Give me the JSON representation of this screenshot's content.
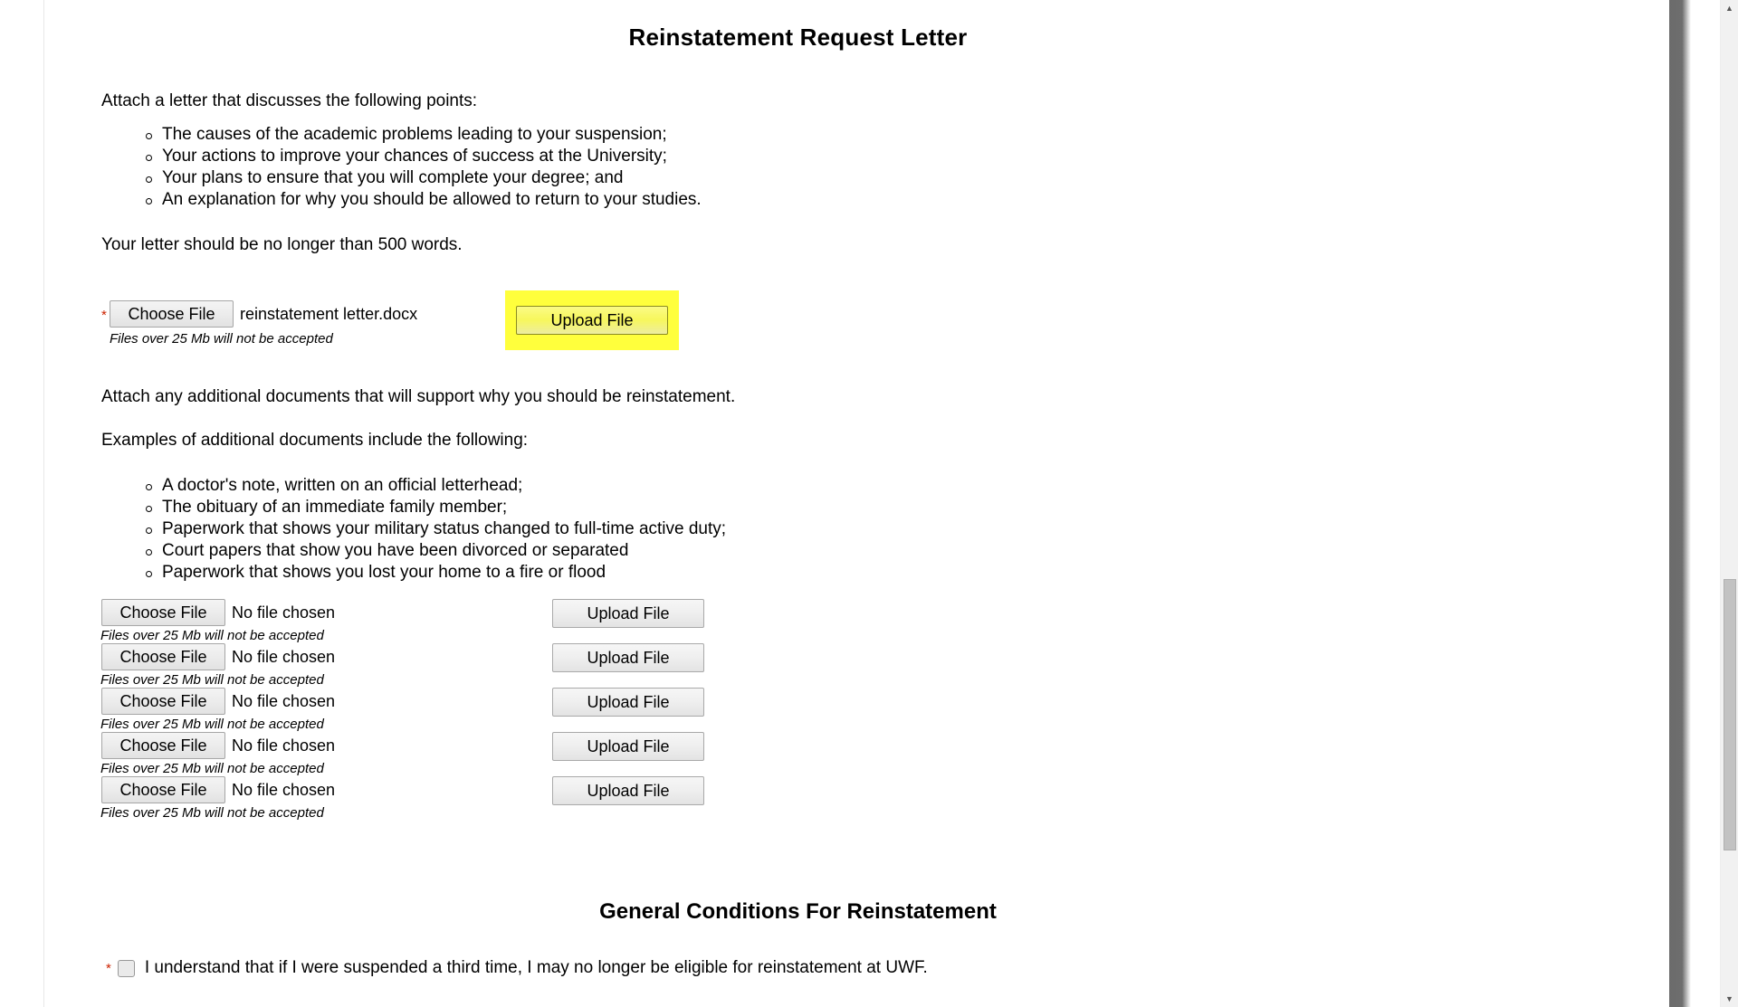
{
  "page": {
    "title": "Reinstatement Request Letter",
    "section_title": "General Conditions For Reinstatement"
  },
  "letter_section": {
    "intro": "Attach a letter that discusses the following points:",
    "points": [
      "The causes of the academic problems leading to your suspension;",
      "Your actions to improve your chances of success at the University;",
      "Your plans to ensure that you will complete your degree; and",
      "An explanation for why you should be allowed to return to your studies."
    ],
    "word_limit": "Your letter should be no longer than 500 words.",
    "upload": {
      "required_marker": "*",
      "choose_file_label": "Choose File",
      "file_name": "reinstatement letter.docx",
      "size_note": "Files over 25 Mb will not be accepted",
      "upload_label": "Upload File",
      "highlighted": true,
      "highlight_color": "#ffff3c"
    }
  },
  "additional_section": {
    "intro": "Attach any additional documents that will support why you should be reinstatement.",
    "examples_intro": "Examples of additional documents include the following:",
    "examples": [
      "A doctor's note, written on an official letterhead;",
      "The obituary of an immediate family member;",
      "Paperwork that shows your military status changed to full-time active duty;",
      "Court papers that show you have been divorced or separated",
      "Paperwork that shows you lost your home to a fire or flood"
    ],
    "rows": [
      {
        "choose_file_label": "Choose File",
        "file_name": "No file chosen",
        "size_note": "Files over 25 Mb will not be accepted",
        "upload_label": "Upload File"
      },
      {
        "choose_file_label": "Choose File",
        "file_name": "No file chosen",
        "size_note": "Files over 25 Mb will not be accepted",
        "upload_label": "Upload File"
      },
      {
        "choose_file_label": "Choose File",
        "file_name": "No file chosen",
        "size_note": "Files over 25 Mb will not be accepted",
        "upload_label": "Upload File"
      },
      {
        "choose_file_label": "Choose File",
        "file_name": "No file chosen",
        "size_note": "Files over 25 Mb will not be accepted",
        "upload_label": "Upload File"
      },
      {
        "choose_file_label": "Choose File",
        "file_name": "No file chosen",
        "size_note": "Files over 25 Mb will not be accepted",
        "upload_label": "Upload File"
      }
    ]
  },
  "conditions": {
    "required_marker": "*",
    "checkbox_label": "I understand that if I were suspended a third time, I may no longer be eligible for reinstatement at UWF.",
    "checked": false
  },
  "scrollbar": {
    "up_arrow": "▲",
    "down_arrow": "▼"
  },
  "colors": {
    "highlight": "#ffff3c",
    "required_star": "#cc2200",
    "text": "#000000",
    "background": "#ffffff"
  }
}
